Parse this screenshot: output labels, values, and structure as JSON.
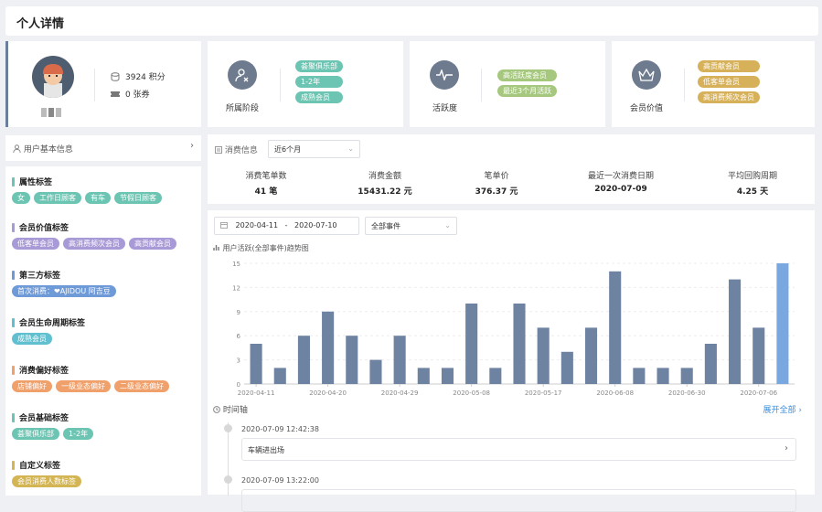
{
  "page": {
    "title": "个人详情"
  },
  "profile": {
    "points": "3924 积分",
    "coupons": "0 张券"
  },
  "cards": [
    {
      "label": "所属阶段",
      "icon": "user-stage-icon",
      "tags": [
        "荟聚俱乐部",
        "1-2年",
        "成熟会员"
      ]
    },
    {
      "label": "活跃度",
      "icon": "pulse-icon",
      "tags": [
        "高活跃度会员",
        "最近3个月活跃"
      ]
    },
    {
      "label": "会员价值",
      "icon": "crown-icon",
      "tags": [
        "高贡献会员",
        "低客单会员",
        "高消费频次会员"
      ]
    }
  ],
  "basic_info": {
    "label": "用户基本信息"
  },
  "label_groups": [
    {
      "title": "属性标签",
      "color": "#6cc4b2",
      "tags": [
        "女",
        "工作日顾客",
        "有车",
        "节假日顾客"
      ],
      "tagColor": "teal"
    },
    {
      "title": "会员价值标签",
      "color": "#a89ad6",
      "tags": [
        "低客单会员",
        "高消费频次会员",
        "高贡献会员"
      ],
      "tagColor": "purple"
    },
    {
      "title": "第三方标签",
      "color": "#6f9ad8",
      "tags": [
        "首次消费：❤AJIDOU 阿吉豆"
      ],
      "tagColor": "blue"
    },
    {
      "title": "会员生命周期标签",
      "color": "#61c0cf",
      "tags": [
        "成熟会员"
      ],
      "tagColor": "cyan"
    },
    {
      "title": "消费偏好标签",
      "color": "#f0a06a",
      "tags": [
        "店铺偏好",
        "一级业态偏好",
        "二级业态偏好"
      ],
      "tagColor": "orange"
    },
    {
      "title": "会员基础标签",
      "color": "#6cc4b2",
      "tags": [
        "荟聚俱乐部",
        "1-2年"
      ],
      "tagColor": "teal"
    },
    {
      "title": "自定义标签",
      "color": "#d4b553",
      "tags": [
        "会员消费人数标签"
      ],
      "tagColor": "yellow"
    }
  ],
  "consumption": {
    "label": "消费信息",
    "period": "近6个月",
    "metrics": [
      {
        "label": "消费笔单数",
        "value": "41 笔"
      },
      {
        "label": "消费金额",
        "value": "15431.22 元"
      },
      {
        "label": "笔单价",
        "value": "376.37 元"
      },
      {
        "label": "最近一次消费日期",
        "value": "2020-07-09"
      },
      {
        "label": "平均回购周期",
        "value": "4.25 天"
      }
    ]
  },
  "trend": {
    "date_start": "2020-04-11",
    "date_sep": "-",
    "date_end": "2020-07-10",
    "event_filter": "全部事件",
    "title": "用户活跃(全部事件)趋势图"
  },
  "chart_data": {
    "type": "bar",
    "title": "用户活跃(全部事件)趋势图",
    "ylim": [
      0,
      15
    ],
    "yticks": [
      0,
      3,
      6,
      9,
      12,
      15
    ],
    "xtick_labels": [
      "2020-04-11",
      "2020-04-20",
      "2020-04-29",
      "2020-05-08",
      "2020-05-17",
      "2020-06-08",
      "2020-06-30",
      "2020-07-06"
    ],
    "values": [
      5,
      2,
      6,
      9,
      6,
      3,
      6,
      2,
      2,
      10,
      2,
      10,
      7,
      4,
      7,
      14,
      2,
      2,
      2,
      5,
      13,
      7,
      15
    ],
    "bar_color": "#6e83a2",
    "highlight_color": "#79a8e0",
    "highlight_index": 22
  },
  "timeline": {
    "label": "时间轴",
    "expand": "展开全部",
    "events": [
      {
        "time": "2020-07-09 12:42:38",
        "text": "车辆进出场"
      },
      {
        "time": "2020-07-09 13:22:00",
        "text": ""
      }
    ]
  }
}
